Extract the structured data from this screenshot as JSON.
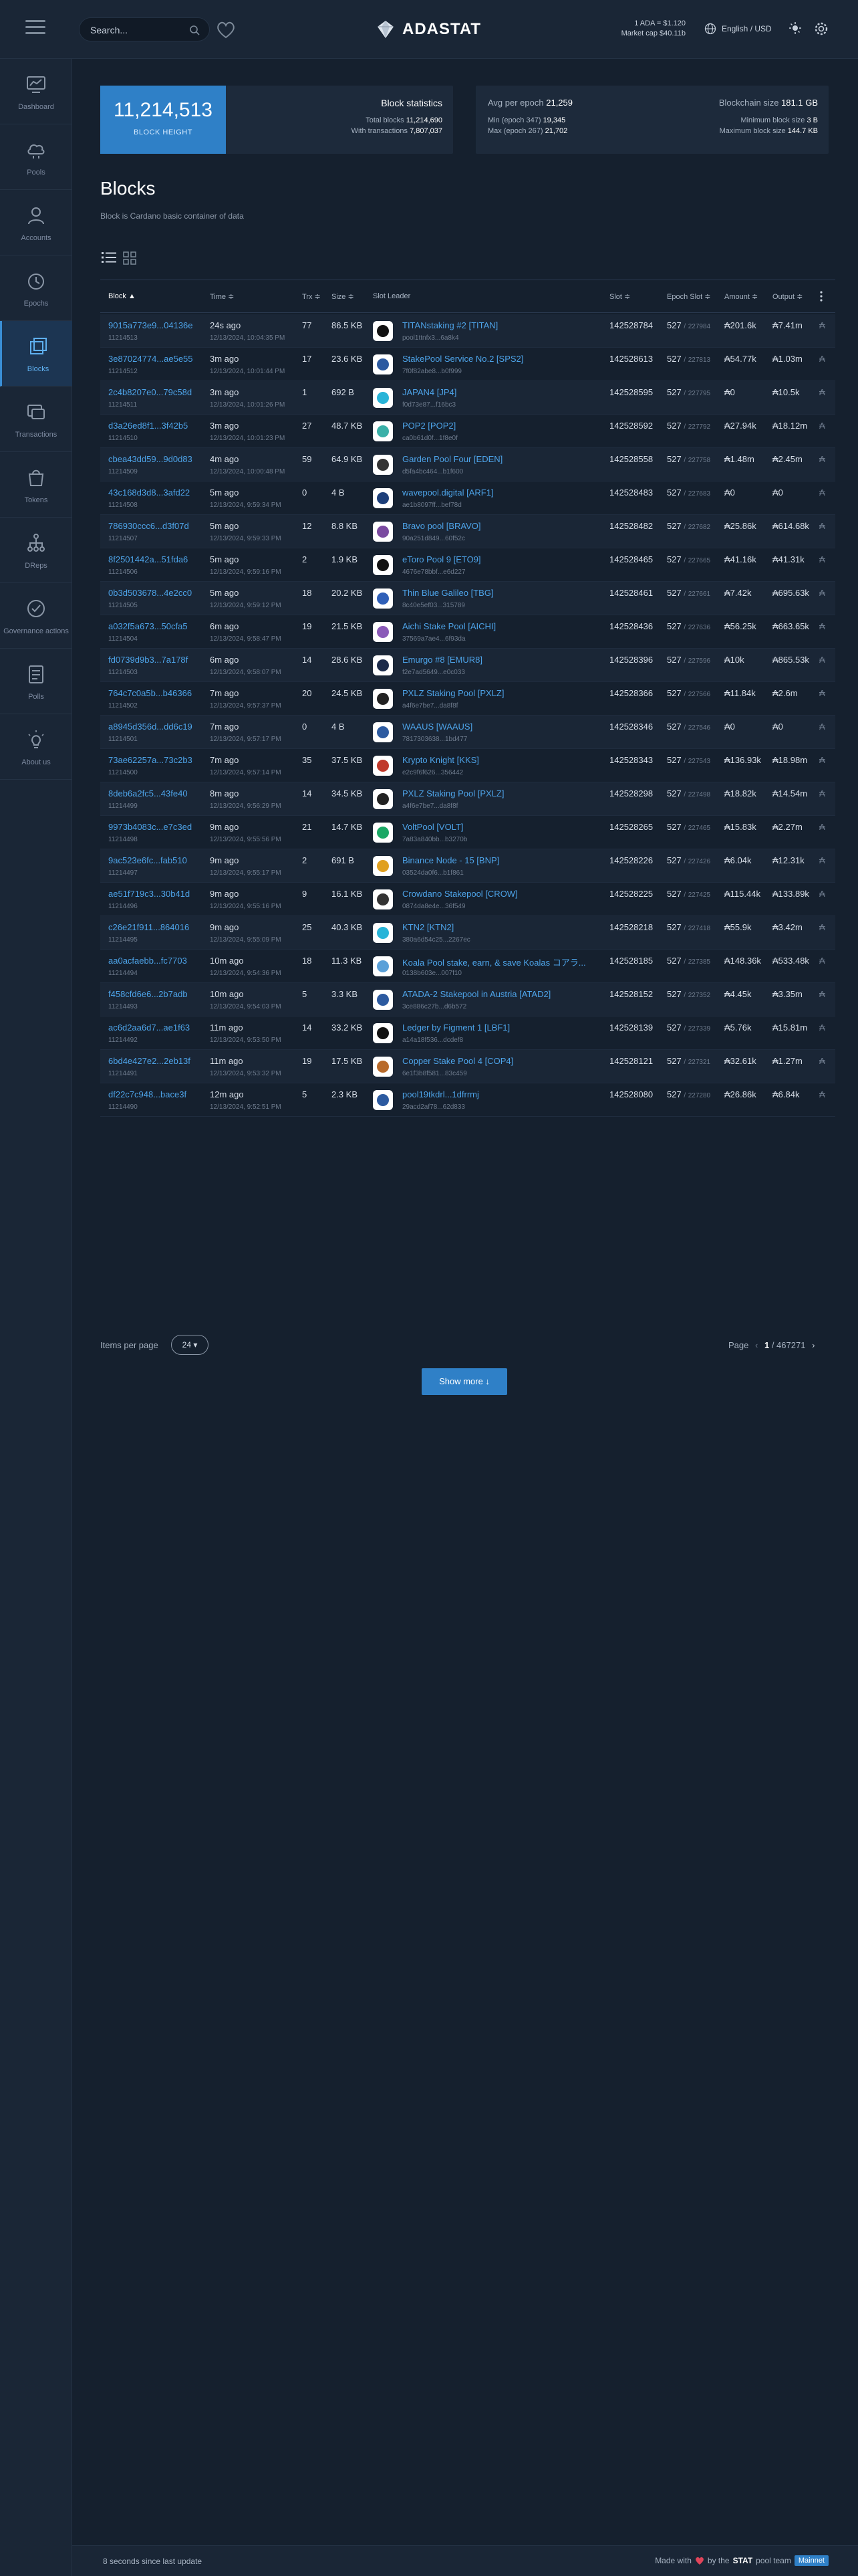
{
  "header": {
    "search_placeholder": "Search...",
    "brand": "ADASTAT",
    "ada_price": "1 ADA = $1.120",
    "market_cap": "Market cap $40.11b",
    "language": "English / USD"
  },
  "sidebar": {
    "items": [
      {
        "label": "Dashboard",
        "icon": "dashboard-icon"
      },
      {
        "label": "Pools",
        "icon": "pools-icon"
      },
      {
        "label": "Accounts",
        "icon": "accounts-icon"
      },
      {
        "label": "Epochs",
        "icon": "epochs-icon"
      },
      {
        "label": "Blocks",
        "icon": "blocks-icon",
        "active": true
      },
      {
        "label": "Transactions",
        "icon": "transactions-icon"
      },
      {
        "label": "Tokens",
        "icon": "tokens-icon"
      },
      {
        "label": "DReps",
        "icon": "dreps-icon"
      },
      {
        "label": "Governance actions",
        "icon": "governance-icon"
      },
      {
        "label": "Polls",
        "icon": "polls-icon"
      },
      {
        "label": "About us",
        "icon": "about-icon"
      }
    ]
  },
  "stats": {
    "block_height": "11,214,513",
    "block_height_label": "BLOCK HEIGHT",
    "card_title": "Block statistics",
    "total_blocks_label": "Total blocks",
    "total_blocks": "11,214,690",
    "with_tx_label": "With transactions",
    "with_tx": "7,807,037",
    "avg_label": "Avg per epoch",
    "avg": "21,259",
    "min_label": "Min (epoch 347)",
    "min": "19,345",
    "max_label": "Max (epoch 267)",
    "max": "21,702",
    "chain_size_label": "Blockchain size",
    "chain_size": "181.1 GB",
    "min_block_label": "Minimum block size",
    "min_block": "3 B",
    "max_block_label": "Maximum block size",
    "max_block": "144.7 KB"
  },
  "page": {
    "title": "Blocks",
    "subtitle": "Block is Cardano basic container of data"
  },
  "table": {
    "headers": {
      "block": "Block ▲",
      "time": "Time ≑",
      "txs": "Trx ≑",
      "size": "Size ≑",
      "leader": "Slot Leader",
      "slot": "Slot ≑",
      "epoch_slot": "Epoch Slot ≑",
      "amount": "Amount ≑",
      "output": "Output ≑"
    },
    "rows": [
      {
        "hash": "9015a773e9...04136e",
        "height": "11214513",
        "time": "24s ago",
        "date": "12/13/2024, 10:04:35 PM",
        "txs": "77",
        "size": "86.5 KB",
        "pool": "TITANstaking #2 [TITAN]",
        "pool_id": "pool1ttnfx3...6a8k4",
        "pool_color": "#111111",
        "slot": "142528784",
        "epoch": "527",
        "eslot": "227984",
        "amount": "₳201.6k",
        "output": "₳7.41m"
      },
      {
        "hash": "3e87024774...ae5e55",
        "height": "11214512",
        "time": "3m ago",
        "date": "12/13/2024, 10:01:44 PM",
        "txs": "17",
        "size": "23.6 KB",
        "pool": "StakePool Service No.2 [SPS2]",
        "pool_id": "7f0f82abe8...b0f999",
        "pool_color": "#2c5aa0",
        "slot": "142528613",
        "epoch": "527",
        "eslot": "227813",
        "amount": "₳54.77k",
        "output": "₳1.03m"
      },
      {
        "hash": "2c4b8207e0...79c58d",
        "height": "11214511",
        "time": "3m ago",
        "date": "12/13/2024, 10:01:26 PM",
        "txs": "1",
        "size": "692 B",
        "pool": "JAPAN4 [JP4]",
        "pool_id": "f0d73e87...f16bc3",
        "pool_color": "#28b4d8",
        "slot": "142528595",
        "epoch": "527",
        "eslot": "227795",
        "amount": "₳0",
        "output": "₳10.5k"
      },
      {
        "hash": "d3a26ed8f1...3f42b5",
        "height": "11214510",
        "time": "3m ago",
        "date": "12/13/2024, 10:01:23 PM",
        "txs": "27",
        "size": "48.7 KB",
        "pool": "POP2 [POP2]",
        "pool_id": "ca0b61d0f...1f8e0f",
        "pool_color": "#3ab0a8",
        "slot": "142528592",
        "epoch": "527",
        "eslot": "227792",
        "amount": "₳27.94k",
        "output": "₳18.12m"
      },
      {
        "hash": "cbea43dd59...9d0d83",
        "height": "11214509",
        "time": "4m ago",
        "date": "12/13/2024, 10:00:48 PM",
        "txs": "59",
        "size": "64.9 KB",
        "pool": "Garden Pool Four [EDEN]",
        "pool_id": "d5fa4bc464...b1f600",
        "pool_color": "#333333",
        "slot": "142528558",
        "epoch": "527",
        "eslot": "227758",
        "amount": "₳1.48m",
        "output": "₳2.45m"
      },
      {
        "hash": "43c168d3d8...3afd22",
        "height": "11214508",
        "time": "5m ago",
        "date": "12/13/2024, 9:59:34 PM",
        "txs": "0",
        "size": "4 B",
        "pool": "wavepool.digital [ARF1]",
        "pool_id": "ae1b8097ff...bef78d",
        "pool_color": "#1d3f7a",
        "slot": "142528483",
        "epoch": "527",
        "eslot": "227683",
        "amount": "₳0",
        "output": "₳0"
      },
      {
        "hash": "786930ccc6...d3f07d",
        "height": "11214507",
        "time": "5m ago",
        "date": "12/13/2024, 9:59:33 PM",
        "txs": "12",
        "size": "8.8 KB",
        "pool": "Bravo pool [BRAVO]",
        "pool_id": "90a251d849...60f52c",
        "pool_color": "#7a4aa0",
        "slot": "142528482",
        "epoch": "527",
        "eslot": "227682",
        "amount": "₳25.86k",
        "output": "₳614.68k"
      },
      {
        "hash": "8f2501442a...51fda6",
        "height": "11214506",
        "time": "5m ago",
        "date": "12/13/2024, 9:59:16 PM",
        "txs": "2",
        "size": "1.9 KB",
        "pool": "eToro Pool 9 [ETO9]",
        "pool_id": "4676e78bbf...e6d227",
        "pool_color": "#111111",
        "slot": "142528465",
        "epoch": "527",
        "eslot": "227665",
        "amount": "₳41.16k",
        "output": "₳41.31k"
      },
      {
        "hash": "0b3d503678...4e2cc0",
        "height": "11214505",
        "time": "5m ago",
        "date": "12/13/2024, 9:59:12 PM",
        "txs": "18",
        "size": "20.2 KB",
        "pool": "Thin Blue Galileo [TBG]",
        "pool_id": "8c40e5ef03...315789",
        "pool_color": "#2f5fb8",
        "slot": "142528461",
        "epoch": "527",
        "eslot": "227661",
        "amount": "₳7.42k",
        "output": "₳695.63k"
      },
      {
        "hash": "a032f5a673...50cfa5",
        "height": "11214504",
        "time": "6m ago",
        "date": "12/13/2024, 9:58:47 PM",
        "txs": "19",
        "size": "21.5 KB",
        "pool": "Aichi Stake Pool [AICHI]",
        "pool_id": "37569a7ae4...6f93da",
        "pool_color": "#8a5ab8",
        "slot": "142528436",
        "epoch": "527",
        "eslot": "227636",
        "amount": "₳56.25k",
        "output": "₳663.65k"
      },
      {
        "hash": "fd0739d9b3...7a178f",
        "height": "11214503",
        "time": "6m ago",
        "date": "12/13/2024, 9:58:07 PM",
        "txs": "14",
        "size": "28.6 KB",
        "pool": "Emurgo #8 [EMUR8]",
        "pool_id": "f2e7ad5649...e0c033",
        "pool_color": "#1b2a4a",
        "slot": "142528396",
        "epoch": "527",
        "eslot": "227596",
        "amount": "₳10k",
        "output": "₳865.53k"
      },
      {
        "hash": "764c7c0a5b...b46366",
        "height": "11214502",
        "time": "7m ago",
        "date": "12/13/2024, 9:57:37 PM",
        "txs": "20",
        "size": "24.5 KB",
        "pool": "PXLZ Staking Pool [PXLZ]",
        "pool_id": "a4f6e7be7...da8f8f",
        "pool_color": "#222222",
        "slot": "142528366",
        "epoch": "527",
        "eslot": "227566",
        "amount": "₳11.84k",
        "output": "₳2.6m"
      },
      {
        "hash": "a8945d356d...dd6c19",
        "height": "11214501",
        "time": "7m ago",
        "date": "12/13/2024, 9:57:17 PM",
        "txs": "0",
        "size": "4 B",
        "pool": "WAAUS [WAAUS]",
        "pool_id": "7817303638...1bd477",
        "pool_color": "#2c5aa0",
        "slot": "142528346",
        "epoch": "527",
        "eslot": "227546",
        "amount": "₳0",
        "output": "₳0"
      },
      {
        "hash": "73ae62257a...73c2b3",
        "height": "11214500",
        "time": "7m ago",
        "date": "12/13/2024, 9:57:14 PM",
        "txs": "35",
        "size": "37.5 KB",
        "pool": "Krypto Knight [KKS]",
        "pool_id": "e2c9f6f626...356442",
        "pool_color": "#c0392b",
        "slot": "142528343",
        "epoch": "527",
        "eslot": "227543",
        "amount": "₳136.93k",
        "output": "₳18.98m"
      },
      {
        "hash": "8deb6a2fc5...43fe40",
        "height": "11214499",
        "time": "8m ago",
        "date": "12/13/2024, 9:56:29 PM",
        "txs": "14",
        "size": "34.5 KB",
        "pool": "PXLZ Staking Pool [PXLZ]",
        "pool_id": "a4f6e7be7...da8f8f",
        "pool_color": "#222222",
        "slot": "142528298",
        "epoch": "527",
        "eslot": "227498",
        "amount": "₳18.82k",
        "output": "₳14.54m"
      },
      {
        "hash": "9973b4083c...e7c3ed",
        "height": "11214498",
        "time": "9m ago",
        "date": "12/13/2024, 9:55:56 PM",
        "txs": "21",
        "size": "14.7 KB",
        "pool": "VoltPool [VOLT]",
        "pool_id": "7a83a840bb...b3270b",
        "pool_color": "#1aa865",
        "slot": "142528265",
        "epoch": "527",
        "eslot": "227465",
        "amount": "₳15.83k",
        "output": "₳2.27m"
      },
      {
        "hash": "9ac523e6fc...fab510",
        "height": "11214497",
        "time": "9m ago",
        "date": "12/13/2024, 9:55:17 PM",
        "txs": "2",
        "size": "691 B",
        "pool": "Binance Node - 15 [BNP]",
        "pool_id": "03524da0f6...b1f861",
        "pool_color": "#e0a020",
        "slot": "142528226",
        "epoch": "527",
        "eslot": "227426",
        "amount": "₳6.04k",
        "output": "₳12.31k"
      },
      {
        "hash": "ae51f719c3...30b41d",
        "height": "11214496",
        "time": "9m ago",
        "date": "12/13/2024, 9:55:16 PM",
        "txs": "9",
        "size": "16.1 KB",
        "pool": "Crowdano Stakepool [CROW]",
        "pool_id": "0874da8e4e...36f549",
        "pool_color": "#333333",
        "slot": "142528225",
        "epoch": "527",
        "eslot": "227425",
        "amount": "₳115.44k",
        "output": "₳133.89k"
      },
      {
        "hash": "c26e21f911...864016",
        "height": "11214495",
        "time": "9m ago",
        "date": "12/13/2024, 9:55:09 PM",
        "txs": "25",
        "size": "40.3 KB",
        "pool": "KTN2 [KTN2]",
        "pool_id": "380a6d54c25...2267ec",
        "pool_color": "#28b4d8",
        "slot": "142528218",
        "epoch": "527",
        "eslot": "227418",
        "amount": "₳55.9k",
        "output": "₳3.42m"
      },
      {
        "hash": "aa0acfaebb...fc7703",
        "height": "11214494",
        "time": "10m ago",
        "date": "12/13/2024, 9:54:36 PM",
        "txs": "18",
        "size": "11.3 KB",
        "pool": "Koala Pool stake, earn, & save Koalas コアラ...",
        "pool_id": "0138b603e...007f10",
        "pool_color": "#5aa0d8",
        "slot": "142528185",
        "epoch": "527",
        "eslot": "227385",
        "amount": "₳148.36k",
        "output": "₳533.48k"
      },
      {
        "hash": "f458cfd6e6...2b7adb",
        "height": "11214493",
        "time": "10m ago",
        "date": "12/13/2024, 9:54:03 PM",
        "txs": "5",
        "size": "3.3 KB",
        "pool": "ATADA-2 Stakepool in Austria [ATAD2]",
        "pool_id": "3ce886c27b...d6b572",
        "pool_color": "#2c5aa0",
        "slot": "142528152",
        "epoch": "527",
        "eslot": "227352",
        "amount": "₳4.45k",
        "output": "₳3.35m"
      },
      {
        "hash": "ac6d2aa6d7...ae1f63",
        "height": "11214492",
        "time": "11m ago",
        "date": "12/13/2024, 9:53:50 PM",
        "txs": "14",
        "size": "33.2 KB",
        "pool": "Ledger by Figment 1 [LBF1]",
        "pool_id": "a14a18f536...dcdef8",
        "pool_color": "#111111",
        "slot": "142528139",
        "epoch": "527",
        "eslot": "227339",
        "amount": "₳5.76k",
        "output": "₳15.81m"
      },
      {
        "hash": "6bd4e427e2...2eb13f",
        "height": "11214491",
        "time": "11m ago",
        "date": "12/13/2024, 9:53:32 PM",
        "txs": "19",
        "size": "17.5 KB",
        "pool": "Copper Stake Pool 4 [COP4]",
        "pool_id": "6e1f3b8f581...83c459",
        "pool_color": "#b86a2a",
        "slot": "142528121",
        "epoch": "527",
        "eslot": "227321",
        "amount": "₳32.61k",
        "output": "₳1.27m"
      },
      {
        "hash": "df22c7c948...bace3f",
        "height": "11214490",
        "time": "12m ago",
        "date": "12/13/2024, 9:52:51 PM",
        "txs": "5",
        "size": "2.3 KB",
        "pool": "pool19tkdrl...1dfrrmj",
        "pool_id": "29acd2af78...62d833",
        "pool_color": "#2c5aa0",
        "slot": "142528080",
        "epoch": "527",
        "eslot": "227280",
        "amount": "₳26.86k",
        "output": "₳6.84k"
      }
    ]
  },
  "pagination": {
    "ipp_label": "Items per page",
    "ipp_value": "24",
    "page_label": "Page",
    "page_num": "1",
    "page_total": "/ 467271",
    "show_more": "Show more ↓"
  },
  "footer": {
    "update": "8 seconds since last update",
    "made_with": "Made with",
    "by_the": "by the",
    "stat": "STAT",
    "pool_team": "pool team",
    "network": "Mainnet"
  },
  "colors": {
    "accent": "#2f80c7",
    "link": "#4da3e8",
    "background": "#15202e"
  }
}
